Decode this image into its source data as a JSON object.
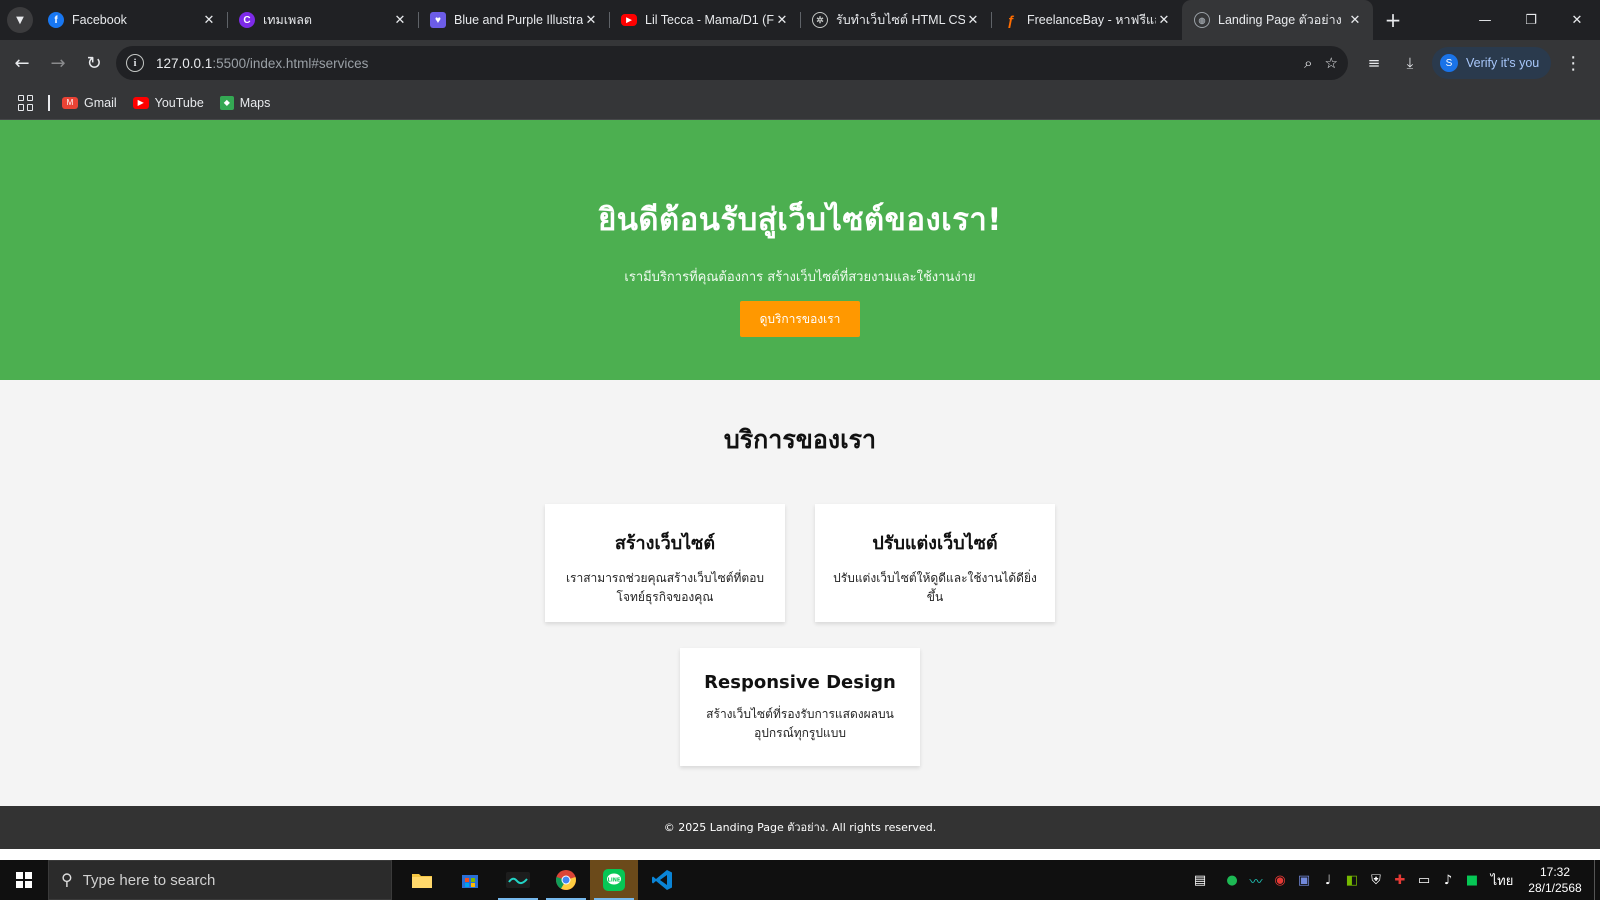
{
  "browser": {
    "tabs": [
      {
        "title": "Facebook",
        "favicon": "facebook-icon",
        "color": "#1877f2",
        "glyph": "f"
      },
      {
        "title": "เทมเพลต",
        "favicon": "canva-icon",
        "color": "#7d2ae8",
        "glyph": "C"
      },
      {
        "title": "Blue and Purple Illustra",
        "favicon": "heart-icon",
        "color": "#6c5ce7",
        "glyph": "♥"
      },
      {
        "title": "Lil Tecca - Mama/D1 (F",
        "favicon": "youtube-icon",
        "color": "#ff0000",
        "glyph": "▶"
      },
      {
        "title": "รับทำเว็บไซต์ HTML CSS",
        "favicon": "openai-icon",
        "color": "#5f6368",
        "glyph": "✲"
      },
      {
        "title": "FreelanceBay - หาฟรีแล",
        "favicon": "freelancebay-icon",
        "color": "#ff6d00",
        "glyph": "ƒ"
      },
      {
        "title": "Landing Page ตัวอย่าง",
        "favicon": "globe-icon",
        "color": "#5f6368",
        "glyph": "◍",
        "active": true
      }
    ],
    "url_host": "127.0.0.1",
    "url_rest": ":5500/index.html#services",
    "profile_label": "Verify it's you",
    "profile_initial": "S",
    "bookmarks": [
      {
        "label": "Gmail",
        "icon": "gmail-icon",
        "color": "#ea4335"
      },
      {
        "label": "YouTube",
        "icon": "youtube-icon",
        "color": "#ff0000"
      },
      {
        "label": "Maps",
        "icon": "maps-icon",
        "color": "#34a853"
      }
    ]
  },
  "page": {
    "hero_title": "ยินดีต้อนรับสู่เว็บไซต์ของเรา!",
    "hero_subtitle": "เรามีบริการที่คุณต้องการ สร้างเว็บไซต์ที่สวยงามและใช้งานง่าย",
    "hero_button": "ดูบริการของเรา",
    "services_title": "บริการของเรา",
    "cards": [
      {
        "title": "สร้างเว็บไซต์",
        "text": "เราสามารถช่วยคุณสร้างเว็บไซต์ที่ตอบโจทย์ธุรกิจของคุณ"
      },
      {
        "title": "ปรับแต่งเว็บไซต์",
        "text": "ปรับแต่งเว็บไซต์ให้ดูดีและใช้งานได้ดียิ่งขึ้น"
      },
      {
        "title": "Responsive Design",
        "text": "สร้างเว็บไซต์ที่รองรับการแสดงผลบนอุปกรณ์ทุกรูปแบบ"
      }
    ],
    "footer": "© 2025 Landing Page ตัวอย่าง. All rights reserved.",
    "colors": {
      "hero_bg": "#4caf50",
      "button_bg": "#ff9800",
      "footer_bg": "#333333"
    }
  },
  "taskbar": {
    "search_placeholder": "Type here to search",
    "language": "ไทย",
    "time": "17:32",
    "date": "28/1/2568"
  }
}
